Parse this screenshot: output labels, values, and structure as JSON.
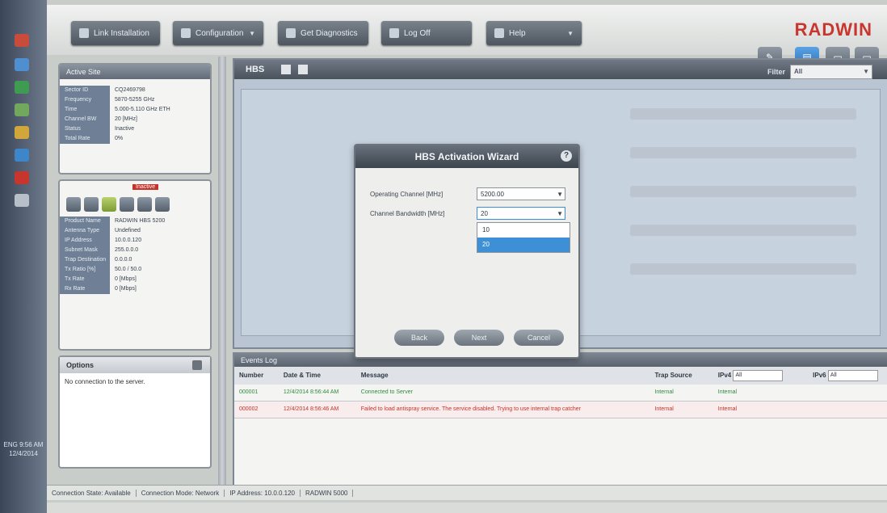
{
  "app": {
    "brand": "RADWIN",
    "toolbar": [
      {
        "label": "Link Installation"
      },
      {
        "label": "Configuration"
      },
      {
        "label": "Get Diagnostics"
      },
      {
        "label": "Log Off"
      },
      {
        "label": "Help"
      }
    ],
    "view_buttons": [
      "✎",
      "▤",
      "▭",
      "▭"
    ]
  },
  "site_panel": {
    "title": "Active Site",
    "rows": [
      {
        "k": "Sector ID",
        "v": "CQ2469798"
      },
      {
        "k": "Frequency",
        "v": "5870-5255 GHz"
      },
      {
        "k": "Time",
        "v": "5.000-5.110 GHz ETH"
      },
      {
        "k": "Channel BW",
        "v": "20 [MHz]"
      },
      {
        "k": "Status",
        "v": "Inactive"
      },
      {
        "k": "Total Rate",
        "v": "0%"
      }
    ]
  },
  "device_panel": {
    "badge": "Inactive",
    "rows": [
      {
        "k": "Product Name",
        "v": "RADWIN HBS 5200"
      },
      {
        "k": "Antenna Type",
        "v": "Undefined"
      },
      {
        "k": "IP Address",
        "v": "10.0.0.120"
      },
      {
        "k": "Subnet Mask",
        "v": "255.0.0.0"
      },
      {
        "k": "Trap Destination",
        "v": "0.0.0.0"
      },
      {
        "k": "Tx Ratio [%]",
        "v": "50.0 / 50.0"
      },
      {
        "k": "Tx Rate",
        "v": "0 [Mbps]"
      },
      {
        "k": "Rx Rate",
        "v": "0 [Mbps]"
      }
    ]
  },
  "options_panel": {
    "title": "Options",
    "text": "No connection to the server."
  },
  "main": {
    "title": "HBS",
    "filter_label": "Filter",
    "filter_value": "All"
  },
  "wizard": {
    "title": "HBS Activation Wizard",
    "fields": [
      {
        "label": "Operating Channel [MHz]",
        "value": "5200.00"
      },
      {
        "label": "Channel Bandwidth [MHz]",
        "value": "20"
      }
    ],
    "dropdown_options": [
      "10",
      "20"
    ],
    "buttons": {
      "back": "Back",
      "next": "Next",
      "cancel": "Cancel"
    }
  },
  "events": {
    "title": "Events Log",
    "columns": [
      "Number",
      "Date & Time",
      "Message",
      "Trap Source",
      "IPv4",
      "IPv6"
    ],
    "ipv4_filter": "All",
    "ipv6_filter": "All",
    "rows": [
      {
        "num": "000001",
        "time": "12/4/2014 8:56:44 AM",
        "msg": "Connected to Server",
        "src": "Internal",
        "ipv4": "Internal",
        "ipv6": "",
        "level": "ok"
      },
      {
        "num": "000002",
        "time": "12/4/2014 8:56:46 AM",
        "msg": "Failed to load antispray service. The service disabled. Trying to use internal trap catcher",
        "src": "Internal",
        "ipv4": "Internal",
        "ipv6": "",
        "level": "err"
      }
    ]
  },
  "statusbar": [
    "Connection State: Available",
    "Connection Mode: Network",
    "IP Address: 10.0.0.120",
    "RADWIN 5000"
  ],
  "taskbar": {
    "clock": "ENG 9:56 AM 12/4/2014"
  }
}
